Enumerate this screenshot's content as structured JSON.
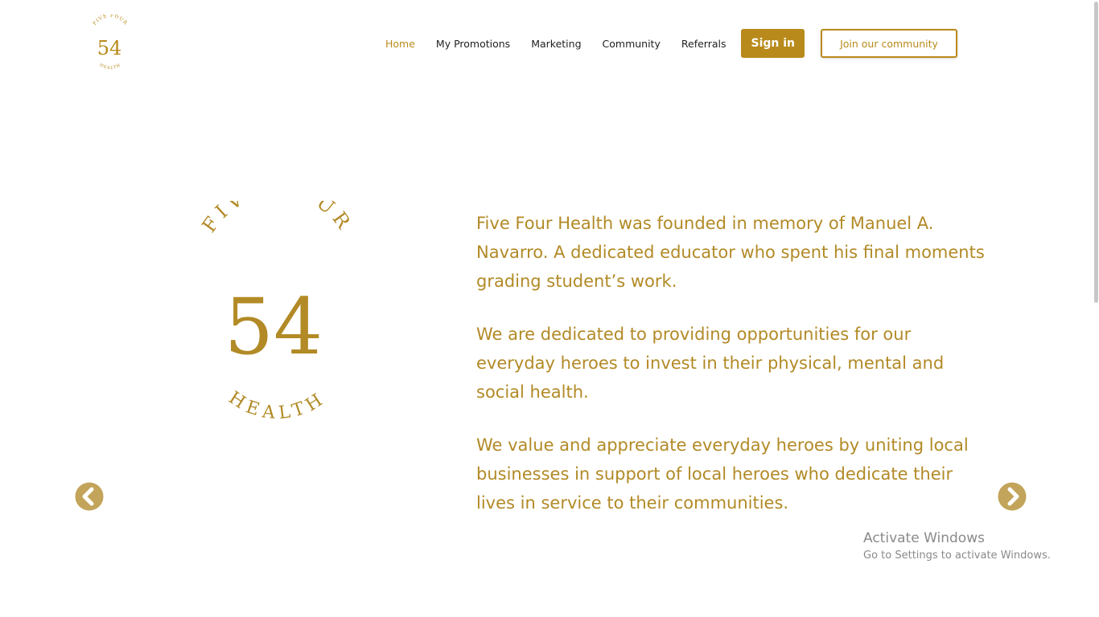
{
  "brand": {
    "arc_top": "FIVE FOUR",
    "numeral": "54",
    "arc_bottom": "HEALTH",
    "color": "#b88a1b"
  },
  "nav": {
    "items": [
      {
        "label": "Home",
        "active": true
      },
      {
        "label": "My Promotions",
        "active": false
      },
      {
        "label": "Marketing",
        "active": false
      },
      {
        "label": "Community",
        "active": false
      },
      {
        "label": "Referrals",
        "active": false
      }
    ],
    "sign_in_label": "Sign in",
    "join_label": "Join our community"
  },
  "hero": {
    "paragraphs": [
      "Five Four Health was founded in memory of Manuel A. Navarro. A dedicated educator who spent his final moments grading student’s work.",
      "We are dedicated to providing opportunities for our everyday heroes to invest in their physical, mental and social health.",
      "We value and appreciate everyday heroes by uniting local businesses in support of local heroes who dedicate their lives in service to their communities."
    ]
  },
  "carousel": {
    "prev_icon": "chevron-left-circle-icon",
    "next_icon": "chevron-right-circle-icon"
  },
  "watermark": {
    "title": "Activate Windows",
    "subtitle": "Go to Settings to activate Windows."
  }
}
